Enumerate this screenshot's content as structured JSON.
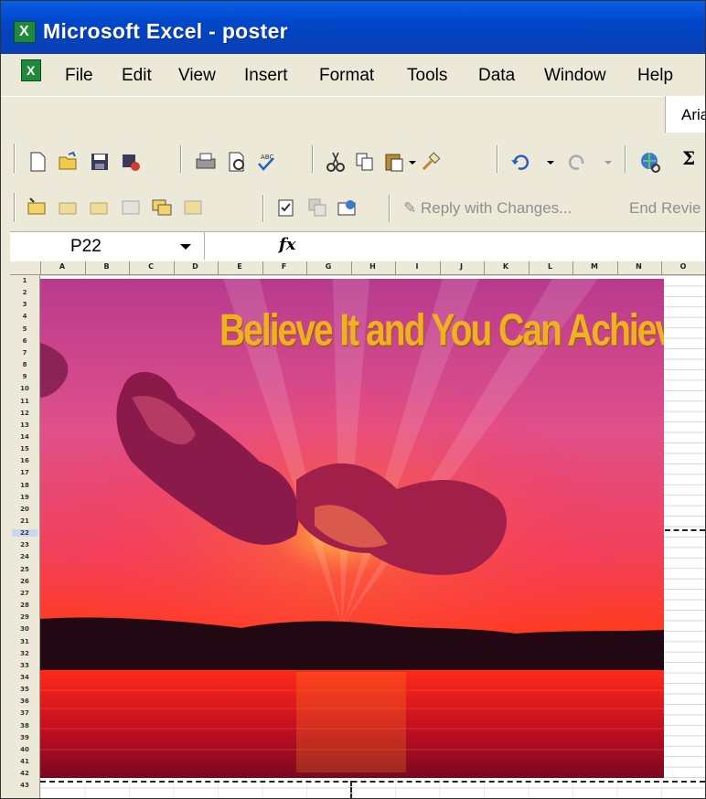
{
  "window": {
    "title": "Microsoft Excel - poster"
  },
  "menu": {
    "items": [
      "File",
      "Edit",
      "View",
      "Insert",
      "Format",
      "Tools",
      "Data",
      "Window",
      "Help"
    ]
  },
  "toolbar": {
    "font_name": "Aria",
    "autosum_symbol": "Σ",
    "reviewing": {
      "reply_label": "Reply with Changes...",
      "end_review_label": "End Revie"
    },
    "icons": {
      "standard": [
        "new-icon",
        "open-icon",
        "save-icon",
        "permission-icon",
        "print-icon",
        "print-preview-icon",
        "spelling-icon",
        "cut-icon",
        "copy-icon",
        "paste-icon",
        "format-painter-icon",
        "undo-icon",
        "redo-icon",
        "hyperlink-icon"
      ],
      "reviewing": [
        "new-comment-icon",
        "previous-comment-icon",
        "next-comment-icon",
        "show-comment-icon",
        "show-all-comments-icon",
        "delete-comment-icon",
        "track-changes-icon",
        "update-file-icon",
        "send-to-recipient-icon",
        "reply-with-changes-icon"
      ]
    }
  },
  "formula_bar": {
    "name_box": "P22",
    "fx_label": "fx",
    "content": ""
  },
  "grid": {
    "columns": [
      "A",
      "B",
      "C",
      "D",
      "E",
      "F",
      "G",
      "H",
      "I",
      "J",
      "K",
      "L",
      "M",
      "N",
      "O"
    ],
    "rows": [
      "1",
      "2",
      "3",
      "4",
      "5",
      "6",
      "7",
      "8",
      "9",
      "10",
      "11",
      "12",
      "13",
      "14",
      "15",
      "16",
      "17",
      "18",
      "19",
      "20",
      "21",
      "22",
      "23",
      "24",
      "25",
      "26",
      "27",
      "28",
      "29",
      "30",
      "31",
      "32",
      "33",
      "34",
      "35",
      "36",
      "37",
      "38",
      "39",
      "40",
      "41",
      "42",
      "43"
    ],
    "active_cell": "P22"
  },
  "poster": {
    "caption": "Believe It and You Can Achieve It"
  },
  "colors": {
    "title_bar": "#0046c8",
    "chrome": "#ece9d8",
    "poster_text": "#f0b024"
  }
}
